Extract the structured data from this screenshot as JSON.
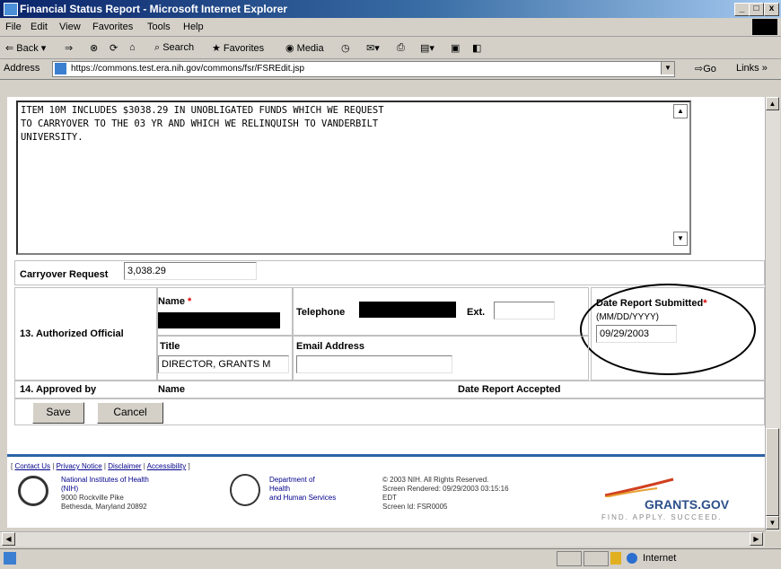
{
  "window": {
    "title": "Financial Status Report - Microsoft Internet Explorer"
  },
  "menu": [
    "File",
    "Edit",
    "View",
    "Favorites",
    "Tools",
    "Help"
  ],
  "toolbar": {
    "back": "Back",
    "forward": "⇒",
    "search": "Search",
    "favorites": "Favorites",
    "media": "Media"
  },
  "address": {
    "label": "Address",
    "url": "https://commons.test.era.nih.gov/commons/fsr/FSREdit.jsp",
    "go": "Go",
    "links": "Links"
  },
  "form": {
    "remarks": "ITEM 10M INCLUDES $3038.29 IN UNOBLIGATED FUNDS WHICH WE REQUEST\nTO CARRYOVER TO THE 03 YR AND WHICH WE RELINQUISH TO VANDERBILT\nUNIVERSITY.",
    "carryover_label": "Carryover Request",
    "carryover_value": "3,038.29",
    "authorized_label": "13. Authorized Official",
    "name_label": "Name",
    "telephone_label": "Telephone",
    "ext_label": "Ext.",
    "date_submitted_label": "Date Report Submitted",
    "date_format": "(MM/DD/YYYY)",
    "date_value": "09/29/2003",
    "title_label": "Title",
    "title_value": "DIRECTOR, GRANTS M",
    "email_label": "Email Address",
    "approved_label": "14. Approved by",
    "approved_name_label": "Name",
    "date_accepted_label": "Date Report Accepted",
    "required_mark": "*"
  },
  "buttons": {
    "save": "Save",
    "cancel": "Cancel"
  },
  "footer": {
    "links": [
      "Contact Us",
      "Privacy Notice",
      "Disclaimer",
      "Accessibility"
    ],
    "nih": [
      "National Institutes of Health",
      "(NIH)",
      "9000 Rockville Pike",
      "Bethesda, Maryland 20892"
    ],
    "hhs": [
      "Department of",
      "Health",
      "and Human Services"
    ],
    "info": [
      "© 2003 NIH. All Rights Reserved.",
      "Screen Rendered: 09/29/2003 03:15:16",
      "EDT",
      "Screen Id: FSR0005"
    ],
    "grants_logo": "GRANTS.GOV",
    "grants_tagline": "FIND. APPLY. SUCCEED."
  },
  "status": {
    "zone": "Internet"
  }
}
